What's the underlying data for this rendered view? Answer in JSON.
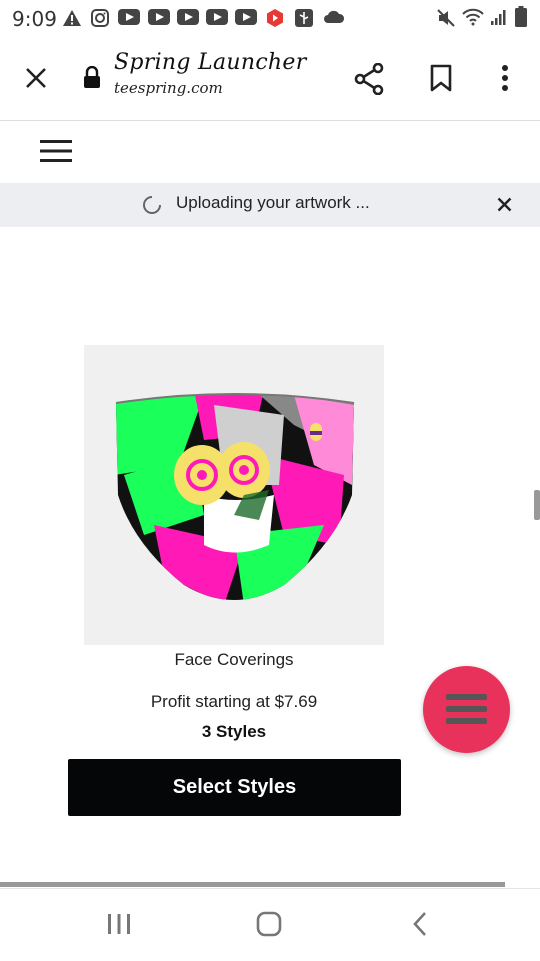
{
  "status_bar": {
    "time": "9:09",
    "icons": [
      "warning-icon",
      "instagram-icon",
      "youtube-icon",
      "youtube-icon",
      "youtube-icon",
      "youtube-icon",
      "youtube-icon",
      "red-app-icon",
      "usb-icon",
      "cloud-icon",
      "mute-icon",
      "wifi-icon",
      "signal-icon",
      "battery-icon"
    ]
  },
  "browser": {
    "title": "Spring Launcher",
    "url": "teespring.com"
  },
  "banner": {
    "text": "Uploading your artwork ..."
  },
  "product": {
    "name": "Face Coverings",
    "profit": "Profit starting at $7.69",
    "styles": "3 Styles",
    "button_label": "Select Styles"
  },
  "colors": {
    "accent": "#e8315b",
    "button": "#050608",
    "banner_bg": "#eceef1"
  }
}
